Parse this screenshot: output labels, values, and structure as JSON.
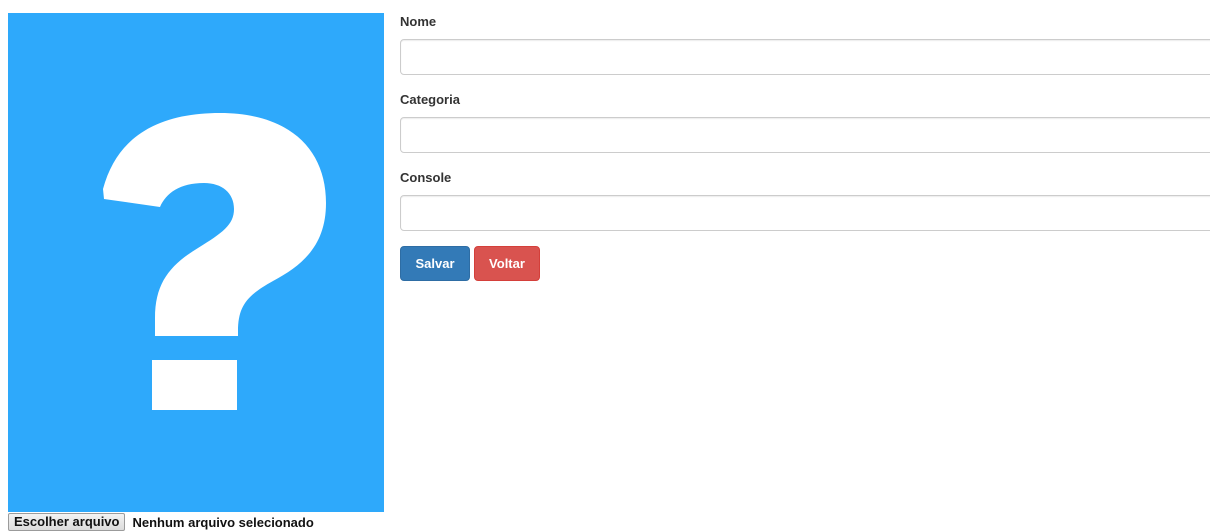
{
  "image": {
    "icon": "question-mark-placeholder",
    "background_color": "#2ea9fb",
    "glyph_color": "#ffffff"
  },
  "file_input": {
    "button_label": "Escolher arquivo",
    "status": "Nenhum arquivo selecionado"
  },
  "form": {
    "fields": [
      {
        "label": "Nome",
        "value": ""
      },
      {
        "label": "Categoria",
        "value": ""
      },
      {
        "label": "Console",
        "value": ""
      }
    ],
    "save_label": "Salvar",
    "back_label": "Voltar",
    "save_color": "#337ab7",
    "back_color": "#d9534f"
  }
}
